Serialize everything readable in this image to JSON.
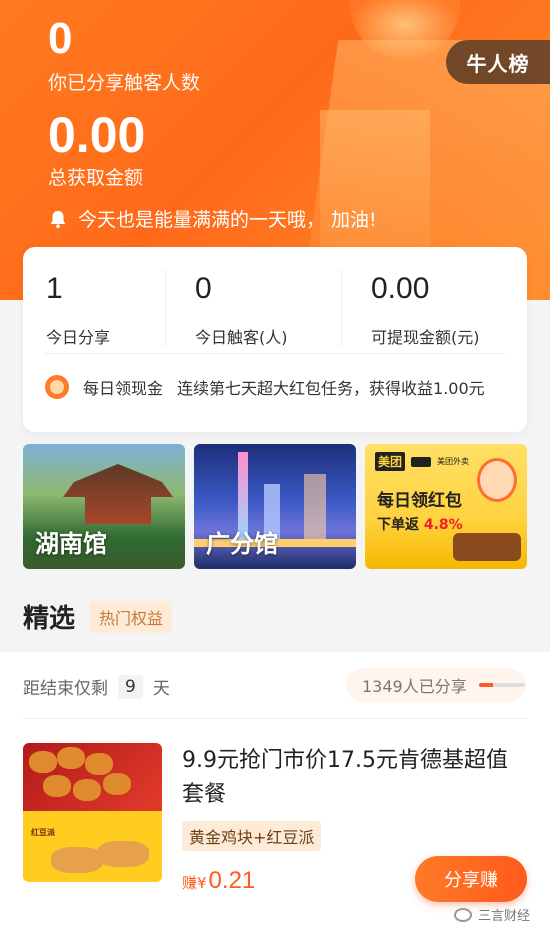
{
  "header": {
    "shared_count": "0",
    "shared_count_label": "你已分享触客人数",
    "total_amount": "0.00",
    "total_amount_label": "总获取金额",
    "notice": "今天也是能量满满的一天哦， 加油!",
    "rank_button": "牛人榜"
  },
  "stats": {
    "items": [
      {
        "value": "1",
        "label": "今日分享"
      },
      {
        "value": "0",
        "label": "今日触客(人)"
      },
      {
        "value": "0.00",
        "label": "可提现金额(元)"
      }
    ],
    "task_name": "每日领现金",
    "task_desc": "连续第七天超大红包任务，获得收益1.00元"
  },
  "tiles": {
    "hunan": "湖南馆",
    "guangfen": "广分馆",
    "meituan": {
      "brand": "美团",
      "brand2": "美团外卖",
      "title": "每日领红包",
      "sub_prefix": "下单返",
      "sub_percent": "4.8%"
    }
  },
  "section": {
    "title": "精选",
    "tag": "热门权益"
  },
  "product": {
    "countdown_prefix": "距结束仅剩",
    "countdown_days": "9",
    "countdown_suffix": "天",
    "shared_text": "1349人已分享",
    "shared_progress": 0.3,
    "title": "9.9元抢门市价17.5元肯德基超值套餐",
    "tag": "黄金鸡块+红豆派",
    "thumb_label": "红豆派",
    "earn_prefix": "赚¥",
    "earn_value": "0.21",
    "share_button": "分享赚"
  },
  "watermark": "三言财经",
  "colors": {
    "accent": "#ff6a1a",
    "price": "#ff5a1f"
  }
}
